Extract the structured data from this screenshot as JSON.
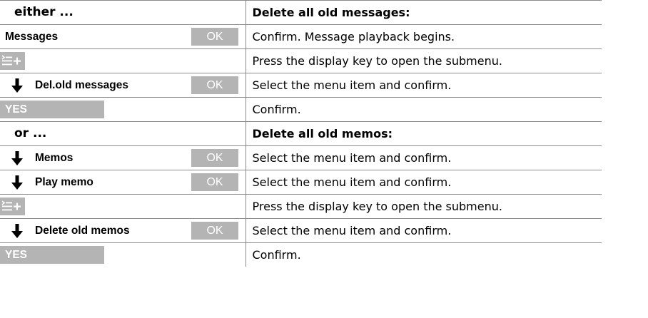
{
  "rows": [
    {
      "type": "branch",
      "left": "either ...",
      "right": "Delete all old messages:",
      "right_bold": true
    },
    {
      "type": "menu",
      "left": "Messages",
      "ok": "OK",
      "arrow": false,
      "right": "Confirm. Message playback begins."
    },
    {
      "type": "menukey",
      "icon": "submenu-key-icon",
      "right": "Press the display key to open the submenu."
    },
    {
      "type": "menu",
      "left": "Del.old messages",
      "ok": "OK",
      "arrow": true,
      "right": "Select the menu item and confirm."
    },
    {
      "type": "yes",
      "left": "YES",
      "right": "Confirm."
    },
    {
      "type": "branch",
      "left": "or ...",
      "right": "Delete all old memos:",
      "right_bold": true
    },
    {
      "type": "menu",
      "left": "Memos",
      "ok": "OK",
      "arrow": true,
      "right": "Select the menu item and confirm."
    },
    {
      "type": "menu",
      "left": "Play memo",
      "ok": "OK",
      "arrow": true,
      "right": "Select the menu item and confirm."
    },
    {
      "type": "menukey",
      "icon": "submenu-key-icon",
      "right": "Press the display key to open the submenu."
    },
    {
      "type": "menu",
      "left": "Delete old memos",
      "ok": "OK",
      "arrow": true,
      "right": "Select the menu item and confirm."
    },
    {
      "type": "yes",
      "left": "YES",
      "right": "Confirm."
    }
  ],
  "colors": {
    "key_background": "#b4b4b4",
    "key_text": "#ffffff",
    "border": "#8a8a8a"
  },
  "icons": {
    "arrow": "arrow-down-icon",
    "ok": "ok-key",
    "menu": "submenu-key-icon"
  }
}
